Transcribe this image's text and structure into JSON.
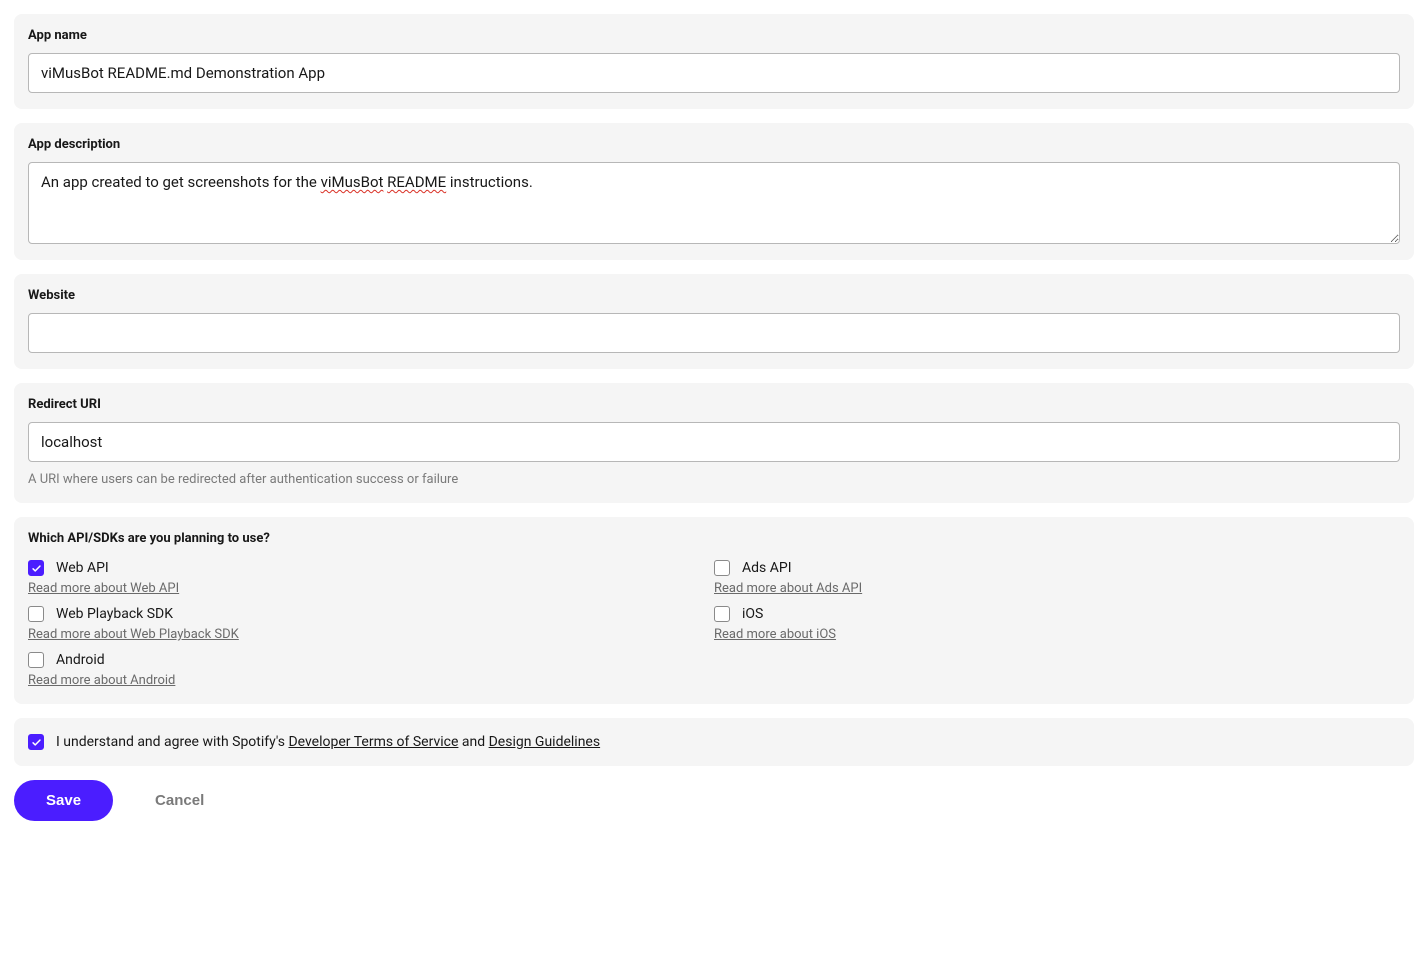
{
  "app_name": {
    "label": "App name",
    "value": "viMusBot README.md Demonstration App"
  },
  "app_description": {
    "label": "App description",
    "value_prefix": "An app created to get screenshots for the ",
    "value_underline1": "viMusBot",
    "value_mid": " ",
    "value_underline2": "README",
    "value_suffix": " instructions."
  },
  "website": {
    "label": "Website",
    "value": ""
  },
  "redirect": {
    "label": "Redirect URI",
    "value": "localhost",
    "helper": "A URI where users can be redirected after authentication success or failure"
  },
  "sdk": {
    "label": "Which API/SDKs are you planning to use?",
    "items": [
      {
        "name": "Web API",
        "read": "Read more about Web API",
        "checked": true
      },
      {
        "name": "Web Playback SDK",
        "read": "Read more about Web Playback SDK",
        "checked": false
      },
      {
        "name": "Android",
        "read": "Read more about Android",
        "checked": false
      },
      {
        "name": "Ads API",
        "read": "Read more about Ads API",
        "checked": false
      },
      {
        "name": "iOS",
        "read": "Read more about iOS",
        "checked": false
      }
    ]
  },
  "terms": {
    "checked": true,
    "prefix": "I understand and agree with Spotify's ",
    "tos": "Developer Terms of Service",
    "mid": " and ",
    "guidelines": "Design Guidelines"
  },
  "buttons": {
    "save": "Save",
    "cancel": "Cancel"
  }
}
